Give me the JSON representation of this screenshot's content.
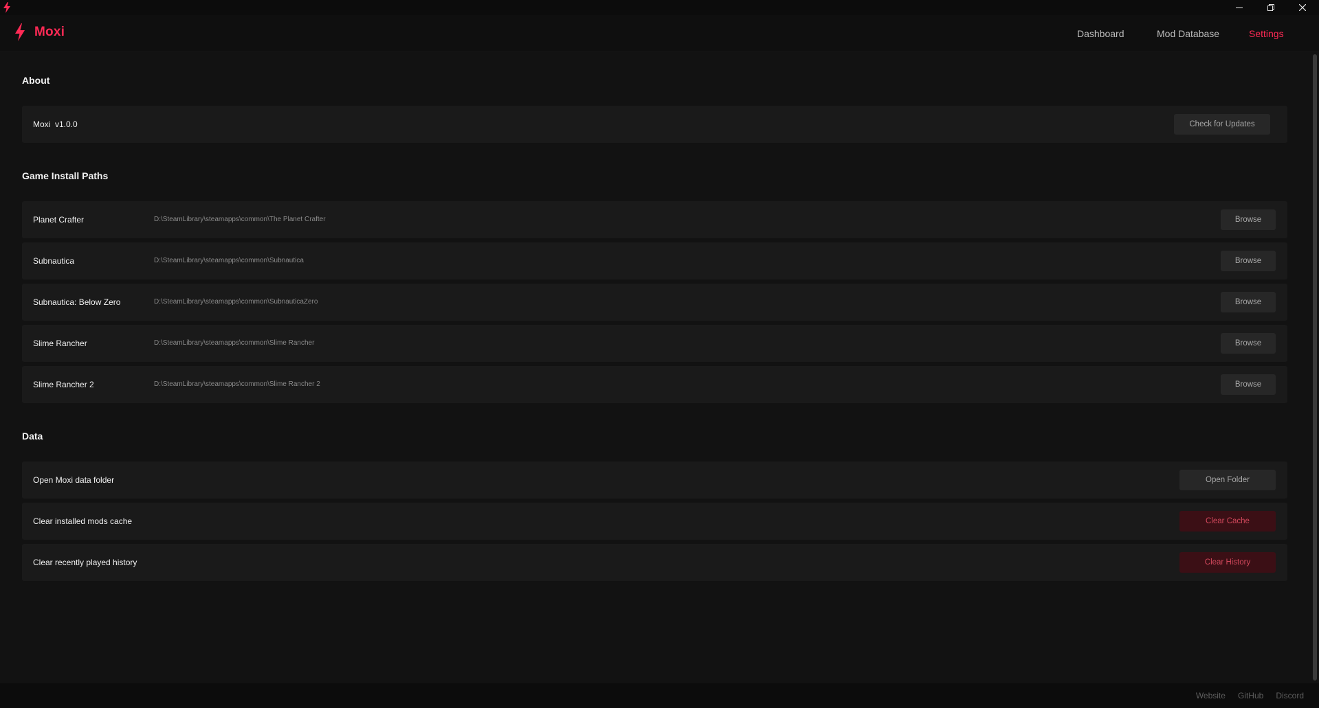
{
  "window": {
    "title": "Moxi"
  },
  "colors": {
    "accent": "#ff2a55",
    "background": "#121212",
    "card": "#1a1a1a",
    "danger_bg": "#3b0f15",
    "danger_text": "#d2485c"
  },
  "brand": {
    "name": "Moxi",
    "icon": "lightning-bolt-icon"
  },
  "nav": {
    "dashboard": "Dashboard",
    "mod_database": "Mod Database",
    "settings": "Settings",
    "active": "Settings"
  },
  "about": {
    "title": "About",
    "version_label": "Moxi  v1.0.0",
    "check_updates": "Check for Updates"
  },
  "paths": {
    "title": "Game Install Paths",
    "browse_label": "Browse",
    "games": [
      {
        "name": "Planet Crafter",
        "path": "D:\\SteamLibrary\\steamapps\\common\\The Planet Crafter"
      },
      {
        "name": "Subnautica",
        "path": "D:\\SteamLibrary\\steamapps\\common\\Subnautica"
      },
      {
        "name": "Subnautica: Below Zero",
        "path": "D:\\SteamLibrary\\steamapps\\common\\SubnauticaZero"
      },
      {
        "name": "Slime Rancher",
        "path": "D:\\SteamLibrary\\steamapps\\common\\Slime Rancher"
      },
      {
        "name": "Slime Rancher 2",
        "path": "D:\\SteamLibrary\\steamapps\\common\\Slime Rancher 2"
      }
    ]
  },
  "data": {
    "title": "Data",
    "open_folder": {
      "label": "Open Moxi data folder",
      "button": "Open Folder"
    },
    "clear_cache": {
      "label": "Clear installed mods cache",
      "button": "Clear Cache"
    },
    "clear_history": {
      "label": "Clear recently played history",
      "button": "Clear History"
    }
  },
  "footer": {
    "website": "Website",
    "github": "GitHub",
    "discord": "Discord"
  }
}
